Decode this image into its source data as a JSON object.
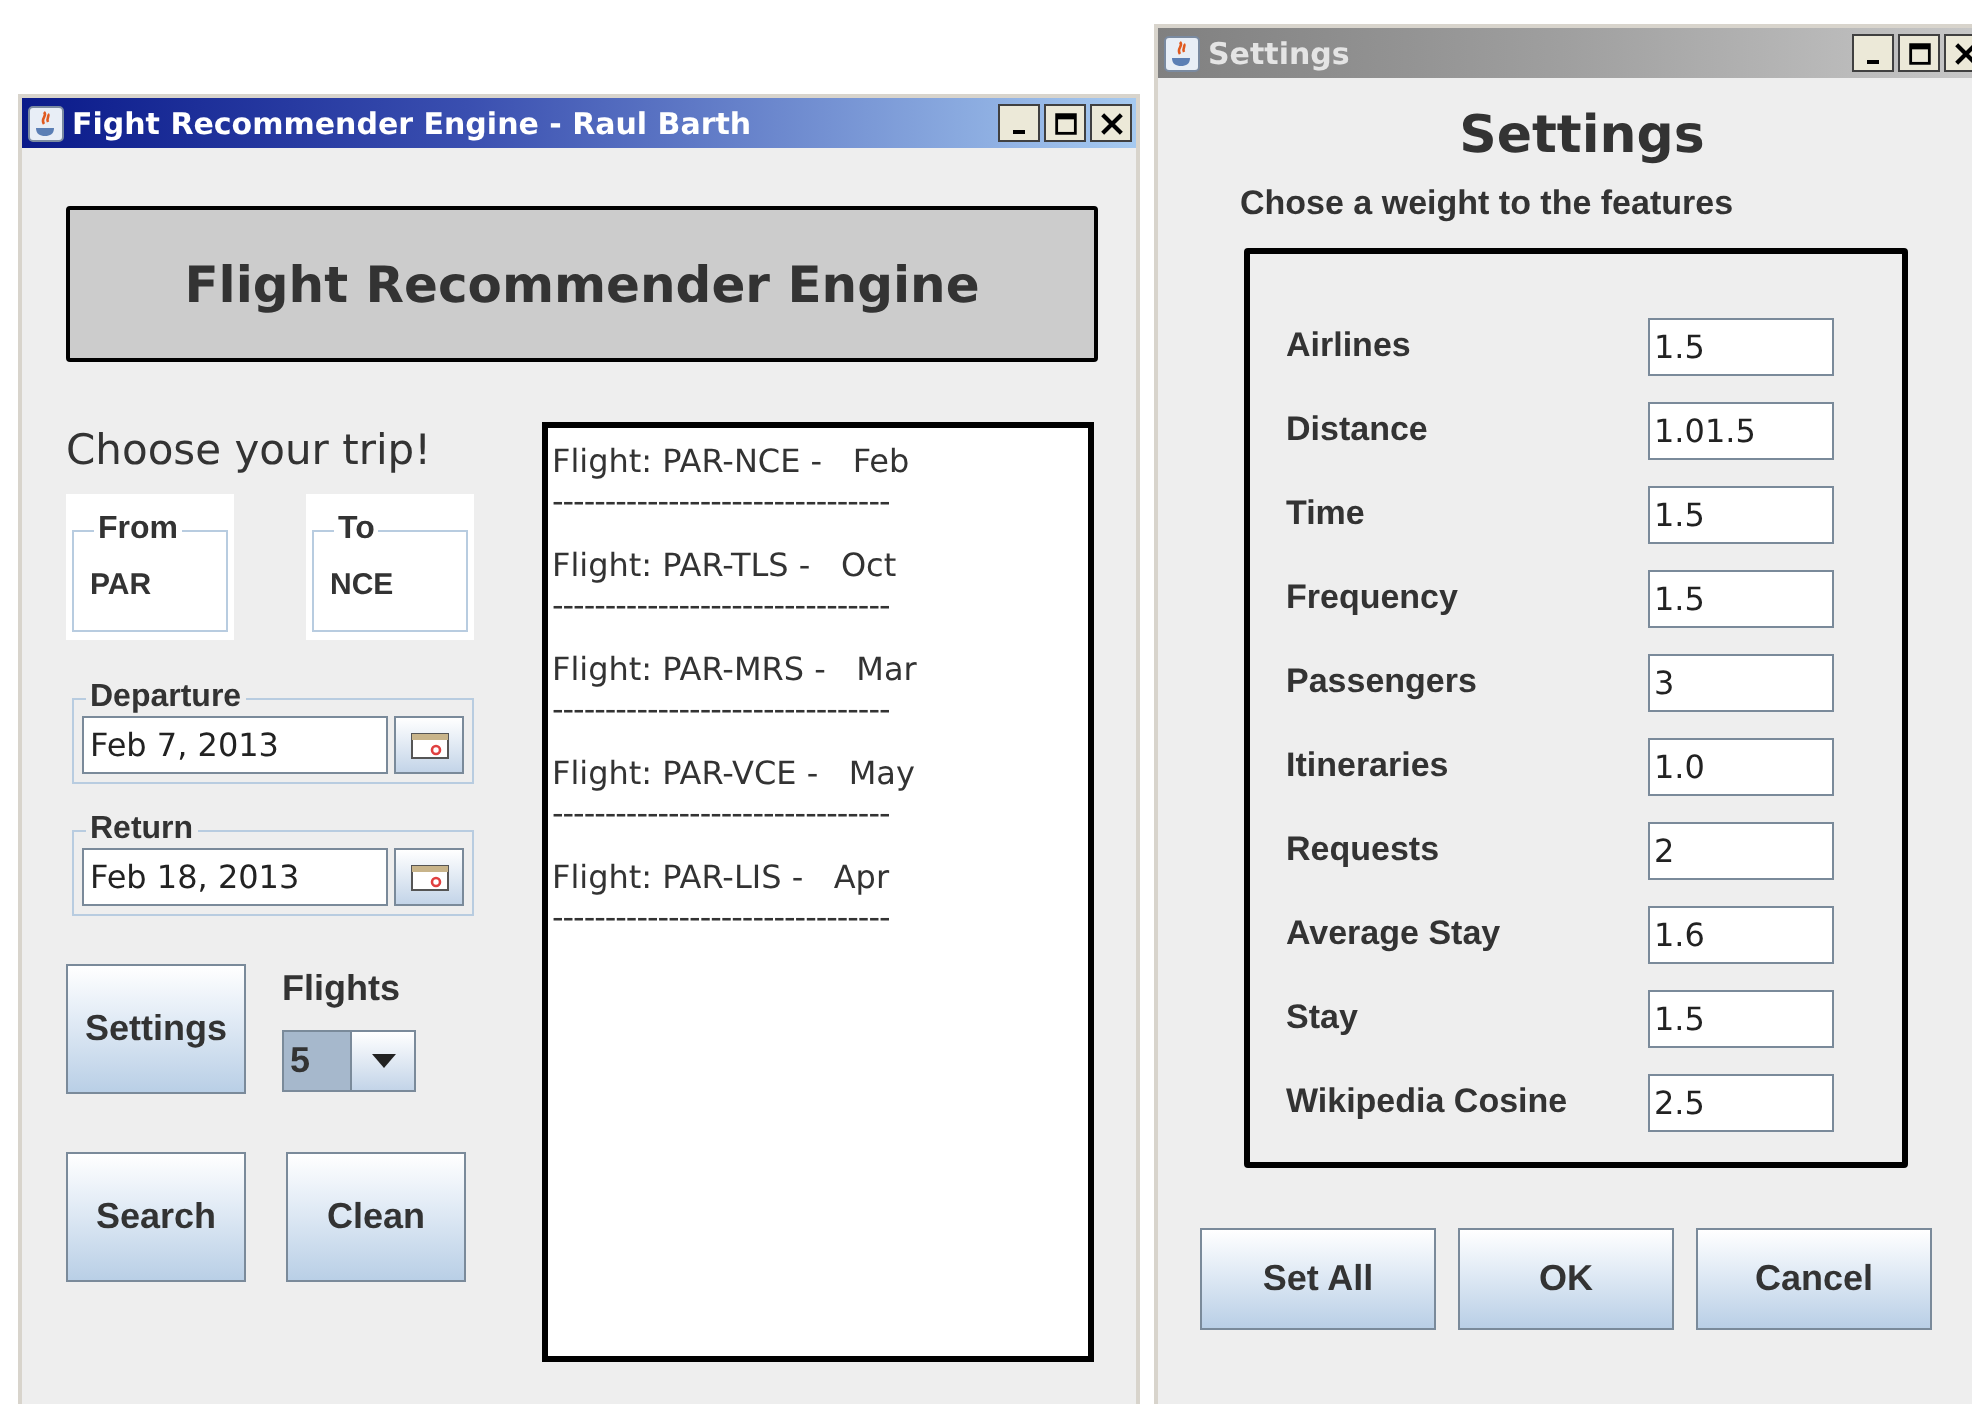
{
  "main_window": {
    "title": "Fight Recommender Engine - Raul Barth",
    "active": true,
    "header": "Flight Recommender Engine",
    "trip_heading": "Choose your trip!",
    "airports": [
      {
        "label": "From",
        "value": "PAR"
      },
      {
        "label": "To",
        "value": "NCE"
      }
    ],
    "dates": [
      {
        "label": "Departure",
        "value": "Feb 7, 2013"
      },
      {
        "label": "Return",
        "value": "Feb 18, 2013"
      }
    ],
    "settings_button": "Settings",
    "flights": {
      "label": "Flights",
      "value": "5"
    },
    "buttons": [
      "Search",
      "Clean"
    ],
    "results": [
      {
        "text": "Flight: PAR-NCE -   Feb",
        "rule": "--------------------------------"
      },
      {
        "text": "Flight: PAR-TLS -   Oct",
        "rule": "--------------------------------"
      },
      {
        "text": "Flight: PAR-MRS -   Mar",
        "rule": "--------------------------------"
      },
      {
        "text": "Flight: PAR-VCE -   May",
        "rule": "--------------------------------"
      },
      {
        "text": "Flight: PAR-LIS -   Apr",
        "rule": "--------------------------------"
      }
    ]
  },
  "settings_window": {
    "title": "Settings",
    "active": false,
    "heading": "Settings",
    "subheading": "Chose a weight to the features",
    "weights": [
      {
        "label": "Airlines",
        "value": "1.5"
      },
      {
        "label": "Distance",
        "value": "1.01.5"
      },
      {
        "label": "Time",
        "value": "1.5"
      },
      {
        "label": "Frequency",
        "value": "1.5"
      },
      {
        "label": "Passengers",
        "value": "3"
      },
      {
        "label": "Itineraries",
        "value": "1.0"
      },
      {
        "label": "Requests",
        "value": "2"
      },
      {
        "label": "Average Stay",
        "value": "1.6"
      },
      {
        "label": "Stay",
        "value": "1.5"
      },
      {
        "label": "Wikipedia Cosine",
        "value": "2.5"
      }
    ],
    "buttons": [
      "Set All",
      "OK",
      "Cancel"
    ]
  }
}
